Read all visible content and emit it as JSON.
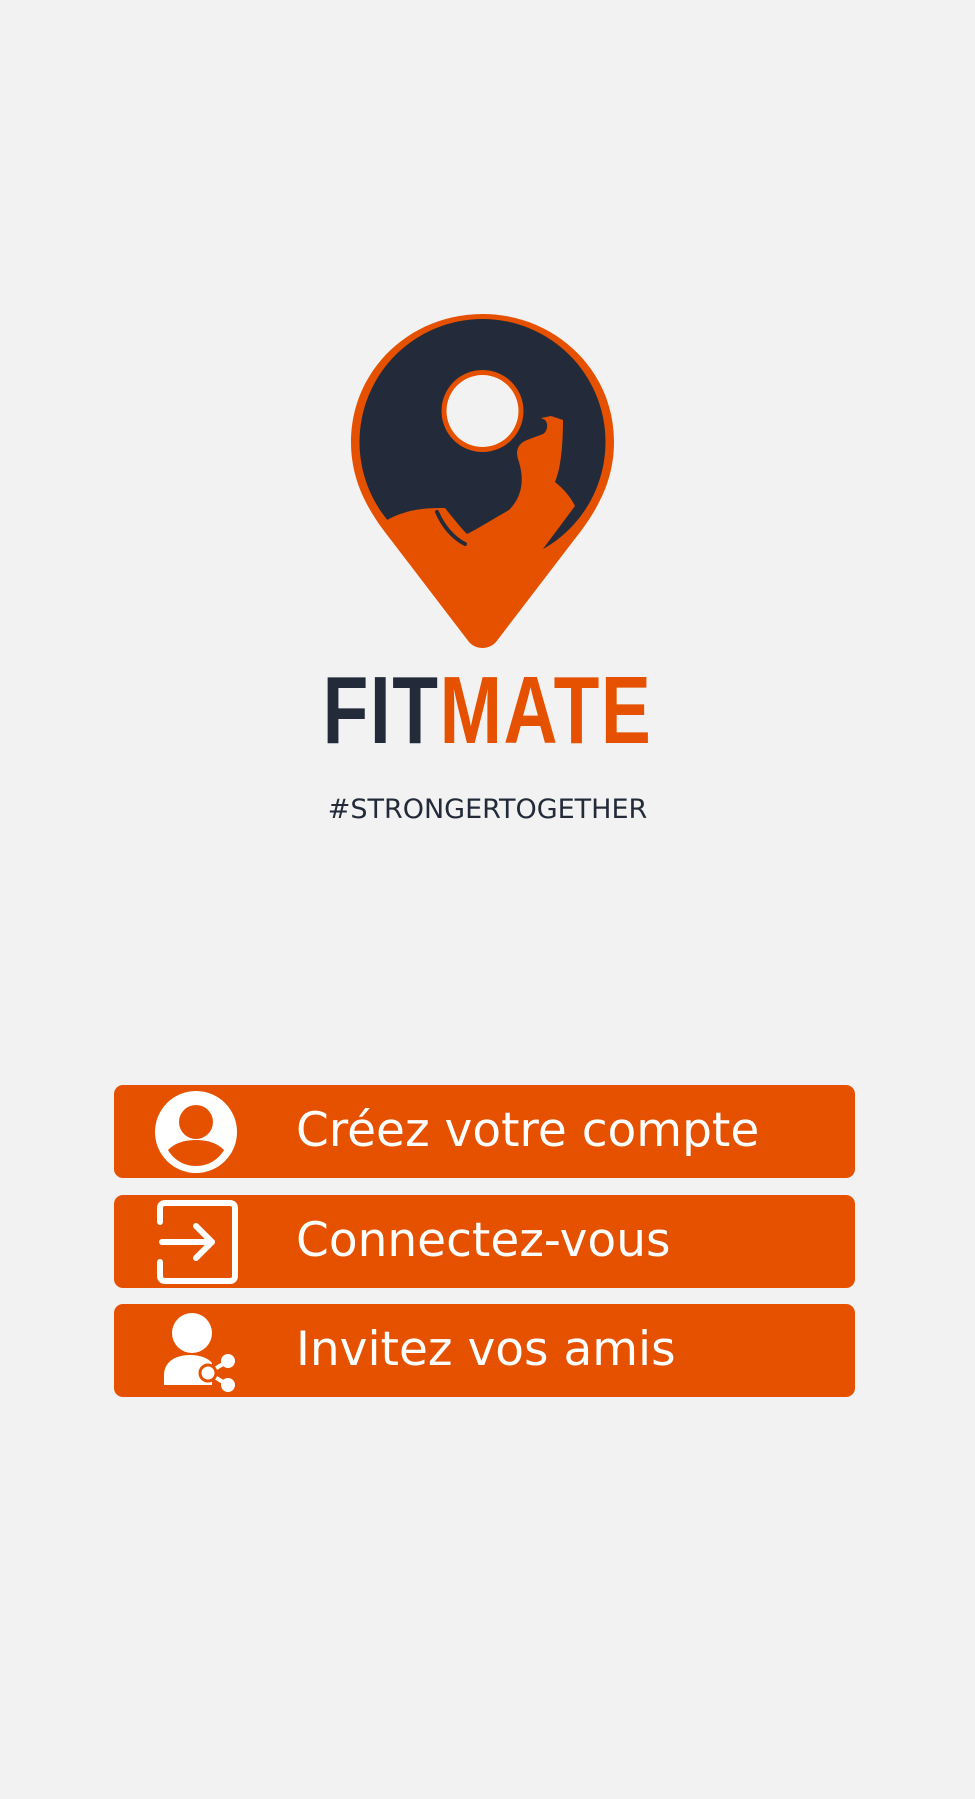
{
  "brand": {
    "name_part_1": "FIT",
    "name_part_2": "MATE",
    "tagline": "#STRONGERTOGETHER",
    "logo_icon": "location-pin-flexed-arm-icon"
  },
  "actions": [
    {
      "label": "Créez votre compte",
      "icon": "user-circle-icon"
    },
    {
      "label": "Connectez-vous",
      "icon": "sign-in-icon"
    },
    {
      "label": "Invitez vos amis",
      "icon": "user-share-icon"
    }
  ],
  "colors": {
    "background": "#f2f2f2",
    "accent": "#e65100",
    "dark": "#232b3a",
    "button_text": "#ffffff"
  }
}
